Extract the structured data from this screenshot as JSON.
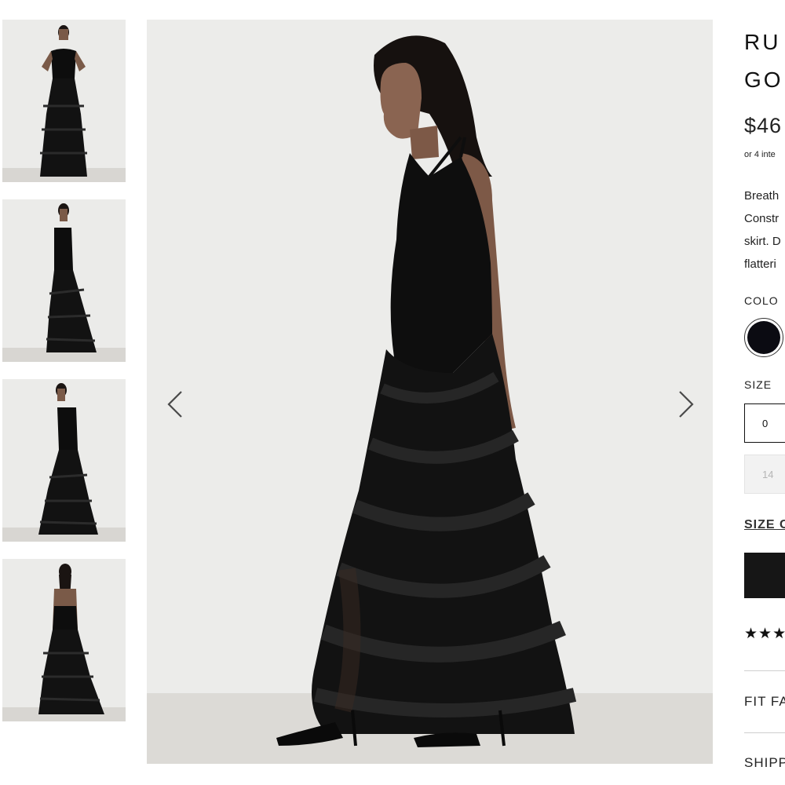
{
  "product": {
    "title_line1": "RU",
    "title_line2": "GO",
    "price": "$46",
    "installments": "or 4 inte",
    "description": [
      "Breath",
      "Constr",
      "skirt. D",
      "flatteri"
    ],
    "color_label": "COLO",
    "size_label": "SIZE",
    "sizes": [
      "0",
      "14"
    ],
    "size_chart_link": "SIZE C",
    "rating_stars": "★★★",
    "accordion": [
      "FIT FA",
      "SHIPP"
    ]
  },
  "colors": {
    "swatch": "#0b0b12",
    "button": "#161616",
    "background": "#ececea"
  },
  "icons": {
    "prev": "chevron-left-icon",
    "next": "chevron-right-icon"
  }
}
